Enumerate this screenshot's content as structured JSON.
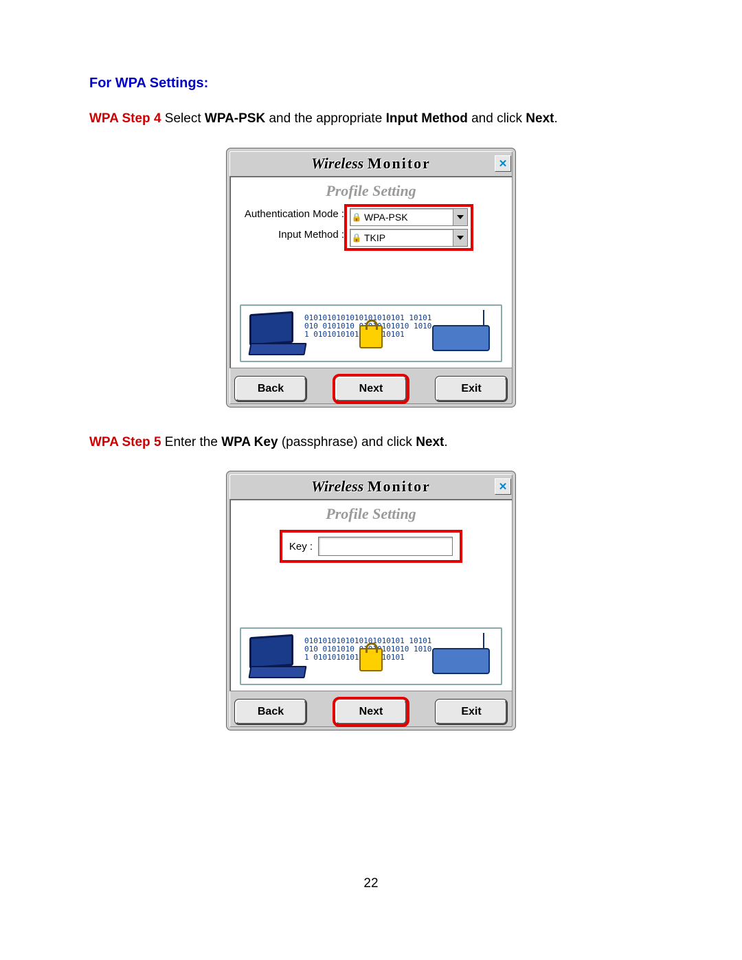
{
  "section_title": "For WPA Settings:",
  "step4": {
    "tag": "WPA Step 4",
    "pre": " Select ",
    "b1": "WPA-PSK",
    "mid": " and the appropriate ",
    "b2": "Input Method",
    "post": " and click ",
    "b3": "Next",
    "end": "."
  },
  "step5": {
    "tag": "WPA Step 5",
    "pre": " Enter the ",
    "b1": "WPA Key",
    "mid": " (passphrase) and click ",
    "b2": "Next",
    "end": "."
  },
  "dialog": {
    "title_wireless": "Wireless",
    "title_monitor": "Monitor",
    "close_glyph": "✕",
    "subhead": "Profile Setting",
    "auth_label": "Authentication Mode :",
    "input_label": "Input Method :",
    "auth_value": "WPA-PSK",
    "input_value": "TKIP",
    "lock_glyph": "🔒",
    "key_label": "Key :",
    "bits_text": "0101010101010101010101 10101010 0101010 01010101010 10101 01010101010101010101",
    "buttons": {
      "back": "Back",
      "next": "Next",
      "exit": "Exit"
    }
  },
  "page_number": "22"
}
